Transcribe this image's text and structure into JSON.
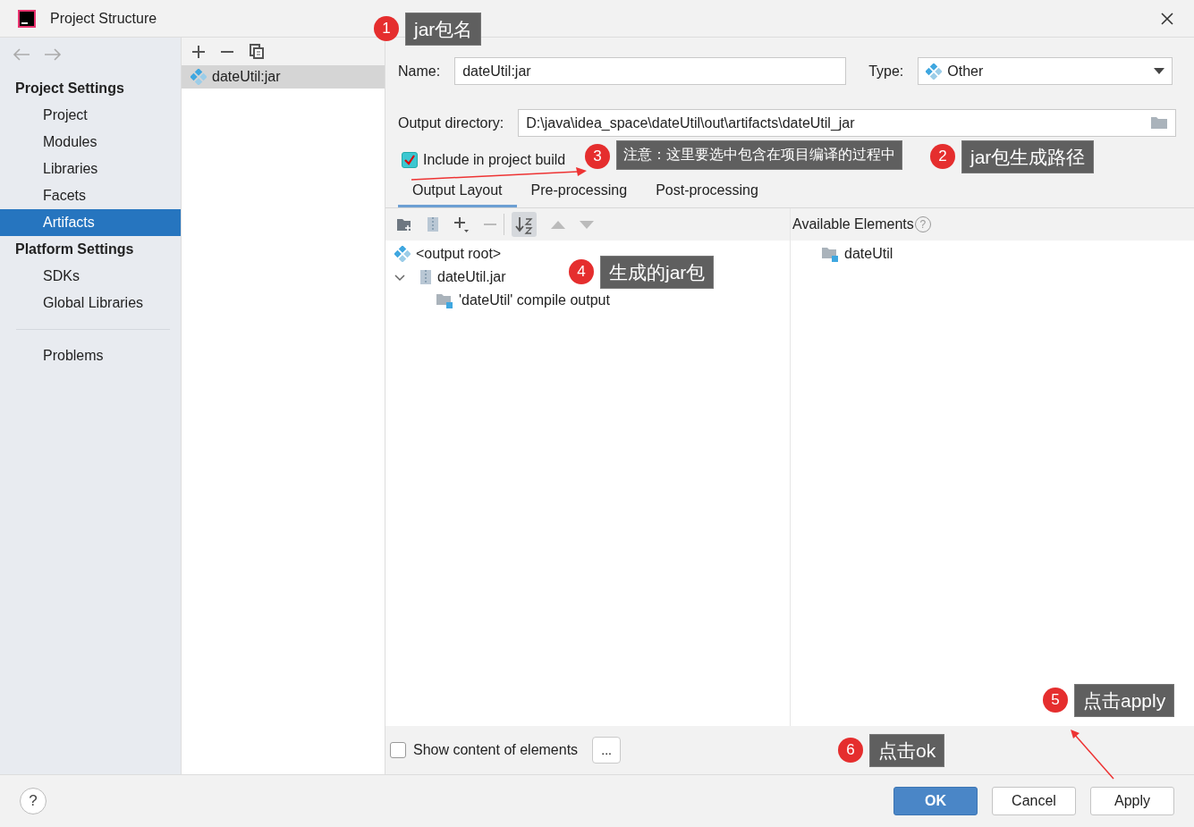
{
  "window": {
    "title": "Project Structure"
  },
  "sidebar": {
    "sections": [
      {
        "heading": "Project Settings",
        "items": [
          {
            "label": "Project",
            "selected": false
          },
          {
            "label": "Modules",
            "selected": false
          },
          {
            "label": "Libraries",
            "selected": false
          },
          {
            "label": "Facets",
            "selected": false
          },
          {
            "label": "Artifacts",
            "selected": true
          }
        ]
      },
      {
        "heading": "Platform Settings",
        "items": [
          {
            "label": "SDKs",
            "selected": false
          },
          {
            "label": "Global Libraries",
            "selected": false
          }
        ]
      }
    ],
    "extra_items": [
      {
        "label": "Problems",
        "selected": false
      }
    ]
  },
  "artifact_list": {
    "items": [
      {
        "label": "dateUtil:jar",
        "selected": true
      }
    ]
  },
  "form": {
    "name_label": "Name:",
    "name_value": "dateUtil:jar",
    "type_label": "Type:",
    "type_value": "Other",
    "output_label": "Output directory:",
    "output_value": "D:\\java\\idea_space\\dateUtil\\out\\artifacts\\dateUtil_jar",
    "include": {
      "label": "Include in project build",
      "checked": true
    }
  },
  "tabs": [
    {
      "label": "Output Layout",
      "selected": true
    },
    {
      "label": "Pre-processing",
      "selected": false
    },
    {
      "label": "Post-processing",
      "selected": false
    }
  ],
  "layout_tree": [
    {
      "label": "<output root>",
      "kind": "root"
    },
    {
      "label": "dateUtil.jar",
      "kind": "jar",
      "expanded": true,
      "children": [
        {
          "label": "'dateUtil' compile output",
          "kind": "module"
        }
      ]
    }
  ],
  "available": {
    "title": "Available Elements",
    "help": "?",
    "items": [
      {
        "label": "dateUtil",
        "kind": "module"
      }
    ]
  },
  "show_content": {
    "label": "Show content of elements",
    "checked": false
  },
  "more_button": "...",
  "help_button": "?",
  "buttons": [
    {
      "label": "OK",
      "kind": "primary"
    },
    {
      "label": "Cancel",
      "kind": "normal"
    },
    {
      "label": "Apply",
      "kind": "normal"
    }
  ],
  "annotations": [
    {
      "number": "1",
      "text": "jar包名"
    },
    {
      "number": "3",
      "text": "注意：这里要选中包含在项目编译的过程中"
    },
    {
      "number": "2",
      "text": "jar包生成路径"
    },
    {
      "number": "4",
      "text": "生成的jar包"
    },
    {
      "number": "5",
      "text": "点击apply"
    },
    {
      "number": "6",
      "text": "点击ok"
    }
  ]
}
